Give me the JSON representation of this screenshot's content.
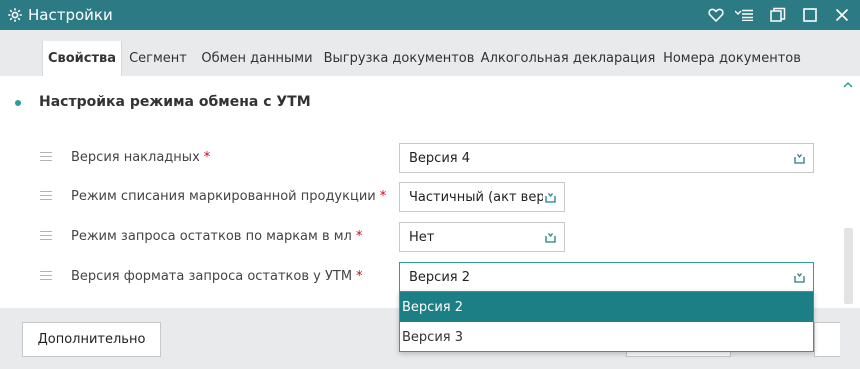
{
  "window": {
    "title": "Настройки",
    "icons": [
      "gear-icon",
      "heart-icon",
      "menu-list-icon",
      "restore-icon",
      "maximize-icon",
      "close-icon"
    ]
  },
  "tabs": [
    {
      "label": "Свойства",
      "active": true
    },
    {
      "label": "Сегмент",
      "active": false
    },
    {
      "label": "Обмен данными",
      "active": false
    },
    {
      "label": "Выгрузка документов",
      "active": false
    },
    {
      "label": "Алкогольная декларация",
      "active": false
    },
    {
      "label": "Номера документов",
      "active": false
    }
  ],
  "section": {
    "title": "Настройка режима обмена с УТМ"
  },
  "fields": [
    {
      "label": "Версия накладных",
      "required_mark": "*",
      "value": "Версия 4"
    },
    {
      "label": "Режим списания маркированной продукции",
      "required_mark": "*",
      "value": "Частичный (акт верс"
    },
    {
      "label": "Режим запроса остатков по маркам в мл",
      "required_mark": "*",
      "value": "Нет"
    },
    {
      "label": "Версия формата запроса остатков у УТМ",
      "required_mark": "*",
      "value": "Версия 2"
    }
  ],
  "dropdown": {
    "options": [
      "Версия 2",
      "Версия 3"
    ],
    "selected": "Версия 2"
  },
  "footer": {
    "more_button": "Дополнительно"
  },
  "colors": {
    "titlebar": "#2c7a84",
    "accent": "#2c9c9c",
    "selected_option": "#1b7f85",
    "required": "#d0021b"
  }
}
